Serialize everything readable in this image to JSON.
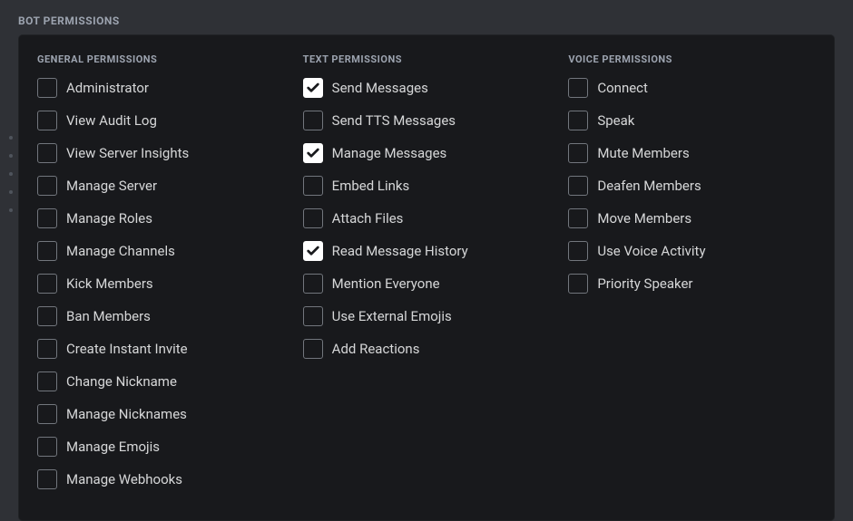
{
  "sectionTitle": "BOT PERMISSIONS",
  "columns": [
    {
      "title": "GENERAL PERMISSIONS",
      "items": [
        {
          "label": "Administrator",
          "checked": false
        },
        {
          "label": "View Audit Log",
          "checked": false
        },
        {
          "label": "View Server Insights",
          "checked": false
        },
        {
          "label": "Manage Server",
          "checked": false
        },
        {
          "label": "Manage Roles",
          "checked": false
        },
        {
          "label": "Manage Channels",
          "checked": false
        },
        {
          "label": "Kick Members",
          "checked": false
        },
        {
          "label": "Ban Members",
          "checked": false
        },
        {
          "label": "Create Instant Invite",
          "checked": false
        },
        {
          "label": "Change Nickname",
          "checked": false
        },
        {
          "label": "Manage Nicknames",
          "checked": false
        },
        {
          "label": "Manage Emojis",
          "checked": false
        },
        {
          "label": "Manage Webhooks",
          "checked": false
        }
      ]
    },
    {
      "title": "TEXT PERMISSIONS",
      "items": [
        {
          "label": "Send Messages",
          "checked": true
        },
        {
          "label": "Send TTS Messages",
          "checked": false
        },
        {
          "label": "Manage Messages",
          "checked": true
        },
        {
          "label": "Embed Links",
          "checked": false
        },
        {
          "label": "Attach Files",
          "checked": false
        },
        {
          "label": "Read Message History",
          "checked": true
        },
        {
          "label": "Mention Everyone",
          "checked": false
        },
        {
          "label": "Use External Emojis",
          "checked": false
        },
        {
          "label": "Add Reactions",
          "checked": false
        }
      ]
    },
    {
      "title": "VOICE PERMISSIONS",
      "items": [
        {
          "label": "Connect",
          "checked": false
        },
        {
          "label": "Speak",
          "checked": false
        },
        {
          "label": "Mute Members",
          "checked": false
        },
        {
          "label": "Deafen Members",
          "checked": false
        },
        {
          "label": "Move Members",
          "checked": false
        },
        {
          "label": "Use Voice Activity",
          "checked": false
        },
        {
          "label": "Priority Speaker",
          "checked": false
        }
      ]
    }
  ]
}
